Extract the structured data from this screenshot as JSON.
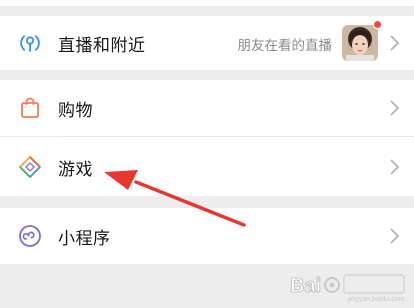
{
  "menu": {
    "live": {
      "label": "直播和附近",
      "subtitle": "朋友在看的直播"
    },
    "shopping": {
      "label": "购物"
    },
    "games": {
      "label": "游戏"
    },
    "mini_programs": {
      "label": "小程序"
    }
  },
  "icons": {
    "live": "live-nearby-icon",
    "shopping": "shopping-bag-icon",
    "games": "games-diamond-icon",
    "mini_programs": "mini-program-icon",
    "chevron": "chevron-right-icon"
  },
  "watermark": {
    "brand": "Bai",
    "sub": "jingyan.baidu.com"
  },
  "colors": {
    "live_icon": "#3d8ee8",
    "shopping_icon": "#f07d5a",
    "mini_program_icon": "#7a6de0",
    "arrow": "#e8372f"
  }
}
